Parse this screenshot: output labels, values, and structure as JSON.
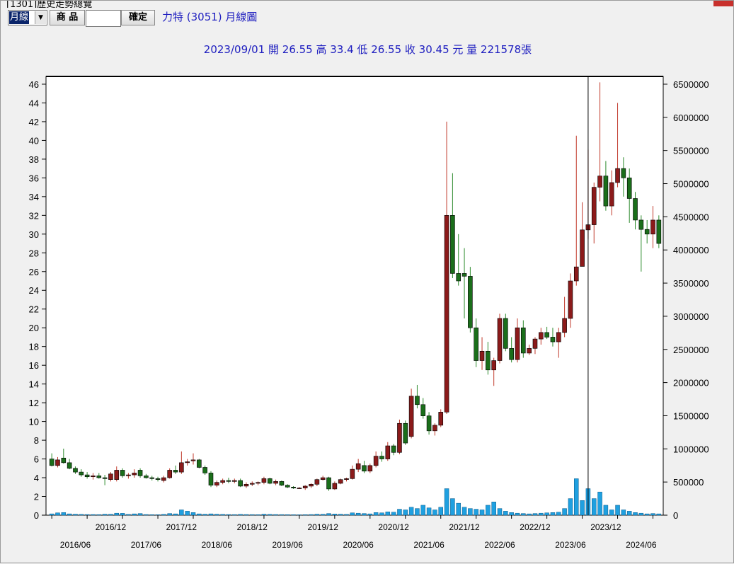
{
  "window": {
    "title": "[1301]歷史走勢總覽"
  },
  "toolbar": {
    "period_selected": "月線",
    "dropdown_arrow": "▼",
    "product_label": "商 品",
    "product_value": "",
    "confirm_label": "確定",
    "chart_title": "力特 (3051) 月線圖"
  },
  "quote_line": "2023/09/01  開 26.55  高 33.4  低 26.55  收 30.45  元  量 221578張",
  "icons": {
    "close": "close-icon",
    "dropdown": "chevron-down-icon"
  },
  "colors": {
    "up": "#8b1a1a",
    "down": "#1a6e1a",
    "wick_up": "#c0392b",
    "wick_down": "#2e8b2e",
    "volume": "#1fa0e0",
    "text_blue": "#2020c0"
  },
  "chart_data": {
    "type": "candlestick",
    "title": "力特 (3051) 月線圖",
    "y_left": {
      "min": 0,
      "max": 46,
      "step": 2
    },
    "y_right": {
      "min": 0,
      "max": 6500000,
      "step": 500000
    },
    "x_labels_top": [
      "2016/12",
      "2017/12",
      "2018/12",
      "2019/12",
      "2020/12",
      "2021/12",
      "2022/12",
      "2023/12"
    ],
    "x_labels_bottom": [
      "2016/06",
      "2017/06",
      "2018/06",
      "2019/06",
      "2020/06",
      "2021/06",
      "2022/06",
      "2023/06",
      "2024/06"
    ],
    "crosshair_date": "2023/09",
    "ohlcv": [
      [
        6.0,
        6.6,
        5.2,
        5.3,
        20000
      ],
      [
        5.3,
        6.2,
        5.1,
        5.9,
        35000
      ],
      [
        6.1,
        7.1,
        5.5,
        5.6,
        40000
      ],
      [
        5.6,
        6.0,
        4.9,
        5.0,
        20000
      ],
      [
        5.0,
        5.2,
        4.4,
        4.6,
        15000
      ],
      [
        4.6,
        4.9,
        4.1,
        4.3,
        12000
      ],
      [
        4.3,
        4.6,
        3.9,
        4.1,
        10000
      ],
      [
        4.1,
        4.5,
        3.8,
        4.2,
        10000
      ],
      [
        4.2,
        4.5,
        3.9,
        4.0,
        9000
      ],
      [
        4.0,
        4.3,
        3.2,
        3.9,
        15000
      ],
      [
        3.8,
        4.6,
        3.6,
        4.4,
        14000
      ],
      [
        3.8,
        5.2,
        3.6,
        4.8,
        30000
      ],
      [
        4.8,
        5.0,
        4.0,
        4.2,
        28000
      ],
      [
        4.2,
        4.5,
        3.9,
        4.3,
        12000
      ],
      [
        4.3,
        4.9,
        4.0,
        4.5,
        20000
      ],
      [
        4.8,
        5.0,
        4.0,
        4.2,
        25000
      ],
      [
        4.2,
        4.4,
        3.9,
        4.0,
        10000
      ],
      [
        4.0,
        4.2,
        3.7,
        3.9,
        8000
      ],
      [
        3.9,
        4.1,
        3.6,
        3.8,
        7000
      ],
      [
        3.7,
        4.2,
        3.5,
        4.0,
        12000
      ],
      [
        4.0,
        5.0,
        3.9,
        4.8,
        25000
      ],
      [
        4.8,
        5.3,
        4.4,
        4.6,
        20000
      ],
      [
        4.6,
        6.8,
        4.4,
        5.6,
        80000
      ],
      [
        5.6,
        6.0,
        5.3,
        5.7,
        60000
      ],
      [
        5.8,
        6.6,
        5.4,
        5.9,
        40000
      ],
      [
        5.9,
        6.0,
        5.0,
        5.1,
        20000
      ],
      [
        5.1,
        5.3,
        4.3,
        4.5,
        15000
      ],
      [
        4.5,
        4.7,
        3.0,
        3.2,
        20000
      ],
      [
        3.2,
        3.7,
        3.0,
        3.5,
        15000
      ],
      [
        3.5,
        3.9,
        3.3,
        3.7,
        12000
      ],
      [
        3.7,
        4.0,
        3.4,
        3.6,
        10000
      ],
      [
        3.6,
        3.9,
        3.4,
        3.7,
        9000
      ],
      [
        3.7,
        3.9,
        3.0,
        3.1,
        12000
      ],
      [
        3.1,
        3.5,
        2.9,
        3.3,
        10000
      ],
      [
        3.3,
        3.6,
        3.1,
        3.4,
        9000
      ],
      [
        3.4,
        3.6,
        3.2,
        3.5,
        8000
      ],
      [
        3.5,
        4.1,
        3.3,
        3.9,
        15000
      ],
      [
        3.9,
        4.0,
        3.3,
        3.4,
        12000
      ],
      [
        3.4,
        3.8,
        3.2,
        3.6,
        10000
      ],
      [
        3.6,
        3.7,
        3.1,
        3.2,
        9000
      ],
      [
        3.2,
        3.3,
        2.9,
        3.0,
        8000
      ],
      [
        3.0,
        3.1,
        2.8,
        2.9,
        7000
      ],
      [
        2.9,
        3.0,
        2.8,
        2.9,
        6000
      ],
      [
        2.9,
        3.2,
        2.7,
        3.1,
        8000
      ],
      [
        3.1,
        3.4,
        2.9,
        3.3,
        10000
      ],
      [
        3.3,
        3.9,
        3.1,
        3.8,
        15000
      ],
      [
        3.8,
        4.2,
        3.7,
        4.0,
        14000
      ],
      [
        4.0,
        4.1,
        2.6,
        2.8,
        25000
      ],
      [
        2.8,
        3.6,
        2.7,
        3.4,
        18000
      ],
      [
        3.4,
        3.9,
        3.3,
        3.8,
        15000
      ],
      [
        3.8,
        4.0,
        3.6,
        3.9,
        12000
      ],
      [
        3.9,
        5.3,
        3.8,
        4.9,
        35000
      ],
      [
        4.9,
        6.0,
        4.6,
        5.5,
        30000
      ],
      [
        5.3,
        5.8,
        4.5,
        4.7,
        25000
      ],
      [
        4.7,
        5.5,
        4.5,
        5.3,
        20000
      ],
      [
        5.3,
        6.8,
        5.1,
        6.3,
        40000
      ],
      [
        6.3,
        6.8,
        5.7,
        6.0,
        35000
      ],
      [
        6.0,
        7.8,
        5.8,
        7.4,
        50000
      ],
      [
        7.4,
        7.6,
        6.4,
        6.7,
        45000
      ],
      [
        6.7,
        10.2,
        6.5,
        9.8,
        90000
      ],
      [
        9.8,
        10.1,
        7.5,
        7.7,
        80000
      ],
      [
        8.4,
        13.5,
        8.2,
        12.7,
        120000
      ],
      [
        12.7,
        13.9,
        11.4,
        11.8,
        100000
      ],
      [
        11.8,
        12.5,
        10.3,
        10.6,
        150000
      ],
      [
        10.6,
        11.0,
        8.6,
        9.0,
        110000
      ],
      [
        9.0,
        9.8,
        8.5,
        9.6,
        80000
      ],
      [
        9.6,
        11.3,
        9.4,
        11.0,
        120000
      ],
      [
        11.0,
        42.0,
        10.8,
        32.0,
        400000
      ],
      [
        32.0,
        36.5,
        25.3,
        25.8,
        250000
      ],
      [
        25.8,
        30.0,
        24.5,
        25.0,
        180000
      ],
      [
        25.8,
        28.5,
        21.0,
        25.5,
        120000
      ],
      [
        25.5,
        26.5,
        19.5,
        20.0,
        100000
      ],
      [
        20.0,
        21.0,
        15.8,
        16.5,
        90000
      ],
      [
        16.5,
        19.0,
        15.5,
        17.5,
        80000
      ],
      [
        17.5,
        18.5,
        15.0,
        15.5,
        150000
      ],
      [
        15.5,
        16.8,
        13.8,
        16.5,
        200000
      ],
      [
        16.5,
        21.5,
        16.2,
        21.0,
        100000
      ],
      [
        21.0,
        21.5,
        17.5,
        17.8,
        60000
      ],
      [
        17.8,
        19.0,
        16.3,
        16.6,
        40000
      ],
      [
        16.6,
        21.0,
        16.3,
        20.0,
        30000
      ],
      [
        20.0,
        20.8,
        16.8,
        17.3,
        25000
      ],
      [
        17.3,
        18.2,
        17.1,
        17.8,
        20000
      ],
      [
        17.8,
        19.0,
        17.2,
        18.8,
        25000
      ],
      [
        18.8,
        20.0,
        18.2,
        19.5,
        30000
      ],
      [
        19.5,
        20.1,
        18.8,
        19.0,
        35000
      ],
      [
        19.0,
        20.0,
        18.0,
        18.5,
        40000
      ],
      [
        18.5,
        20.0,
        16.8,
        19.5,
        45000
      ],
      [
        19.5,
        23.3,
        19.0,
        21.0,
        100000
      ],
      [
        21.0,
        25.8,
        20.0,
        25.0,
        250000
      ],
      [
        25.0,
        40.5,
        24.5,
        26.5,
        550000
      ],
      [
        26.55,
        33.4,
        26.55,
        30.45,
        221578
      ],
      [
        30.45,
        39.0,
        29.5,
        31.0,
        400000
      ],
      [
        31.0,
        35.5,
        29.0,
        35.0,
        250000
      ],
      [
        35.0,
        46.2,
        33.5,
        36.2,
        350000
      ],
      [
        36.2,
        37.8,
        32.5,
        33.0,
        150000
      ],
      [
        33.0,
        36.8,
        32.0,
        35.5,
        80000
      ],
      [
        35.5,
        44.0,
        35.0,
        37.0,
        150000
      ],
      [
        37.0,
        38.2,
        34.0,
        36.0,
        80000
      ],
      [
        36.0,
        37.0,
        31.2,
        33.8,
        60000
      ],
      [
        33.8,
        34.5,
        30.5,
        31.5,
        40000
      ],
      [
        31.5,
        32.0,
        26.0,
        30.5,
        30000
      ],
      [
        30.5,
        31.5,
        29.0,
        30.0,
        20000
      ],
      [
        30.0,
        33.0,
        28.5,
        31.5,
        25000
      ],
      [
        31.5,
        32.0,
        28.5,
        29.0,
        20000
      ]
    ]
  }
}
